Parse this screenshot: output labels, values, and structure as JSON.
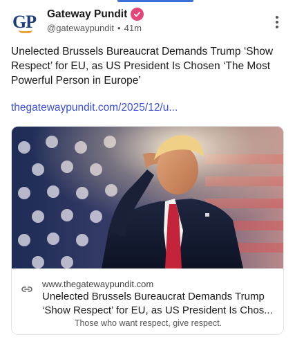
{
  "post": {
    "author_name": "Gateway Pundit",
    "avatar_text": "GP",
    "handle": "@gatewaypundit",
    "separator": "•",
    "time": "41m",
    "text": "Unelected Brussels Bureaucrat Demands Trump ‘Show Respect’ for EU, as US President Is Chosen ‘The Most Powerful Person in Europe’",
    "link": "thegatewaypundit.com/2025/12/u..."
  },
  "card": {
    "domain": "www.thegatewaypundit.com",
    "title": "Unelected Brussels Bureaucrat Demands Trump ‘Show Respect’ for EU, as US President Is Chos...",
    "description": "Those who want respect, give respect."
  },
  "icons": {
    "verified": "verified-badge-icon",
    "menu": "more-vertical-icon",
    "link": "link-icon"
  },
  "colors": {
    "accent": "#3b6fd8",
    "link": "#3b4fd6",
    "verified": "#e5467a",
    "avatar_text": "#1e3f7a",
    "avatar_swoosh": "#e8a33a"
  }
}
